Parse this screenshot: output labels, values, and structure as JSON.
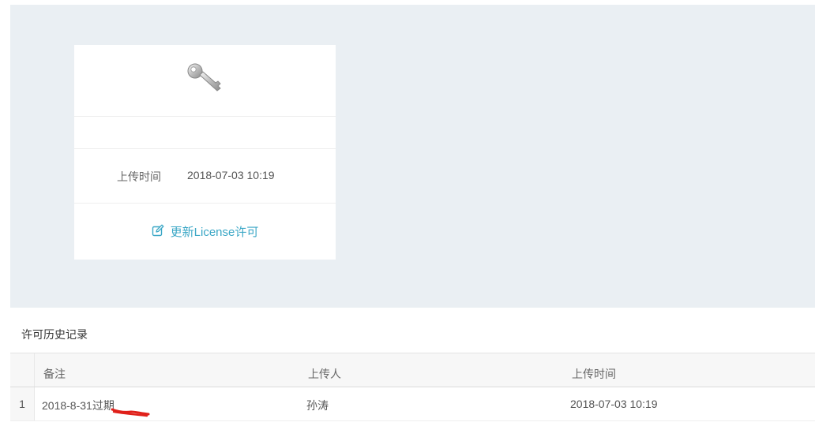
{
  "license_card": {
    "icon": "key-icon",
    "upload_time_label": "上传时间",
    "upload_time_value": "2018-07-03 10:19",
    "update_action_icon": "edit-icon",
    "update_action_label": "更新License许可"
  },
  "history": {
    "title": "许可历史记录",
    "columns": [
      "备注",
      "上传人",
      "上传时间"
    ],
    "rows": [
      {
        "index": "1",
        "note": "2018-8-31过期",
        "uploader": "孙涛",
        "time": "2018-07-03 10:19"
      }
    ]
  },
  "colors": {
    "panel_bg": "#eaeff3",
    "accent": "#3ba7c6",
    "annotation_mark": "#e0201a"
  }
}
